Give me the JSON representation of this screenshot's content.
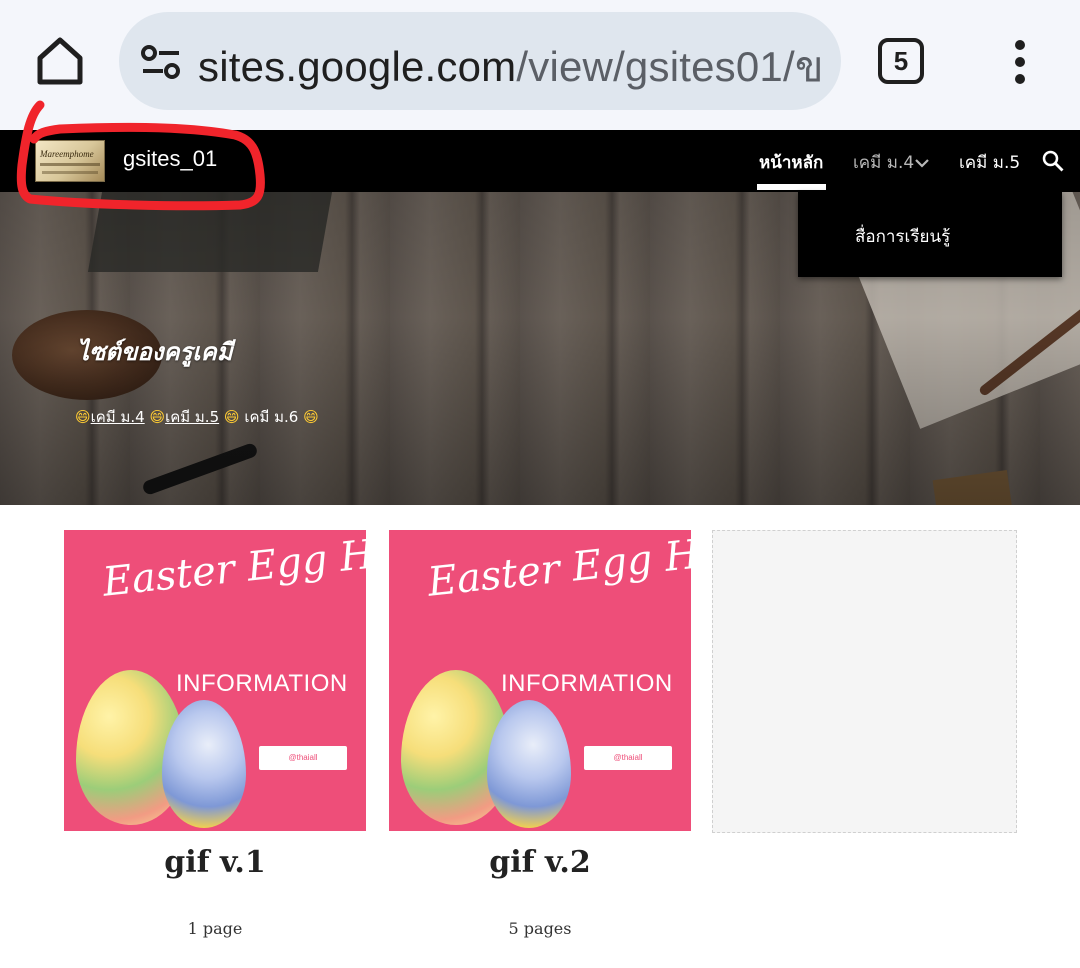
{
  "browser": {
    "url_host": "sites.google.com",
    "url_path": "/view/gsites01/ข",
    "tab_count": "5",
    "icons": {
      "home": "home-icon",
      "site_info": "tune-icon",
      "menu": "more-vert-icon"
    }
  },
  "site": {
    "title": "gsites_01",
    "logo_text": "Mareemphome",
    "nav": [
      {
        "label": "หน้าหลัก",
        "active": true
      },
      {
        "label": "เคมี ม.4",
        "has_dropdown": true
      },
      {
        "label": "เคมี ม.5"
      }
    ],
    "dropdown_items": [
      "สื่อการเรียนรู้"
    ],
    "search_icon": "search-icon"
  },
  "hero": {
    "title": "ไซต์ของครูเคมี",
    "links": [
      "😄",
      "เคมี ม.4",
      "😄",
      "เคมี ม.5",
      "😄",
      "เคมี ม.6",
      "😄"
    ]
  },
  "cards": [
    {
      "image_title": "Easter Egg Hunt",
      "image_subtitle": "INFORMATION",
      "image_tag": "@thaiall",
      "title": "gif v.1",
      "pages": "1 page"
    },
    {
      "image_title": "Easter Egg Hunt",
      "image_subtitle": "INFORMATION",
      "image_tag": "@thaiall",
      "title": "gif v.2",
      "pages": "5 pages"
    }
  ],
  "colors": {
    "header_bg": "#000000",
    "browser_bg": "#f4f6fb",
    "url_pill": "#dfe6ee",
    "card_pink": "#ee4e79",
    "annotation_red": "#f0242b"
  }
}
